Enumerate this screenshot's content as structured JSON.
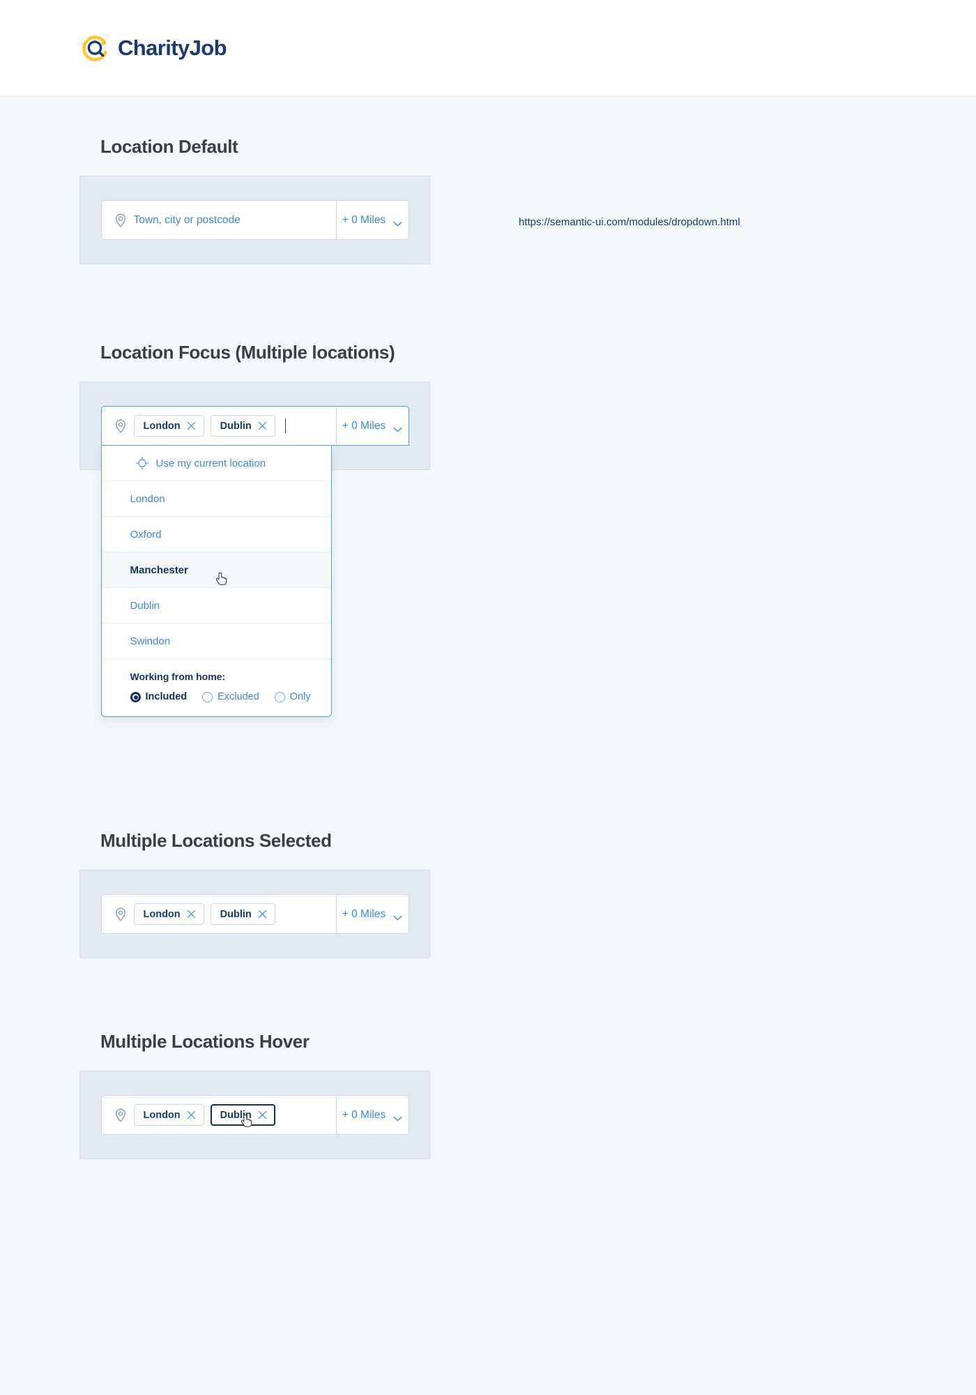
{
  "header": {
    "logo_text": "CharityJob",
    "logo_icon": "magnifier-in-circle-icon"
  },
  "url_note": "https://semantic-ui.com/modules/dropdown.html",
  "icons": {
    "pin": "location-pin-icon",
    "chevron": "chevron-down-icon",
    "tag_remove": "close-x-icon",
    "crosshair": "crosshair-target-icon",
    "cursor": "pointer-cursor-icon"
  },
  "colors": {
    "page_bg": "#f4f8fa",
    "panel_bg": "#e2e9f1",
    "accent_blue": "#3b8ad9",
    "focus_blue": "#5aa0dd",
    "navy": "#13315f",
    "brand_navy": "#1a3a73",
    "brand_yellow": "#ffc629",
    "heading": "#3b3f45",
    "border": "#cfd9e4"
  },
  "miles": {
    "label": "+ 0 Miles"
  },
  "sections": [
    {
      "title": "Location Default",
      "field": {
        "placeholder": "Town, city or postcode",
        "tags": []
      }
    },
    {
      "title": "Location Focus (Multiple locations)",
      "field": {
        "placeholder": "",
        "tags": [
          "London",
          "Dublin"
        ]
      }
    },
    {
      "title": "Multiple Locations Selected",
      "field": {
        "placeholder": "",
        "tags": [
          "London",
          "Dublin"
        ]
      }
    },
    {
      "title": "Multiple Locations Hover",
      "field": {
        "placeholder": "",
        "tags": [
          "London",
          "Dublin"
        ],
        "hovered_tag": "Dublin"
      }
    }
  ],
  "dropdown": {
    "current_location_label": "Use my current location",
    "options": [
      {
        "label": "London",
        "hovered": false
      },
      {
        "label": "Oxford",
        "hovered": false
      },
      {
        "label": "Manchester",
        "hovered": true
      },
      {
        "label": "Dublin",
        "hovered": false
      },
      {
        "label": "Swindon",
        "hovered": false
      }
    ],
    "working_from_home": {
      "label": "Working from home:",
      "options": [
        {
          "label": "Included",
          "selected": true
        },
        {
          "label": "Excluded",
          "selected": false
        },
        {
          "label": "Only",
          "selected": false
        }
      ]
    }
  }
}
